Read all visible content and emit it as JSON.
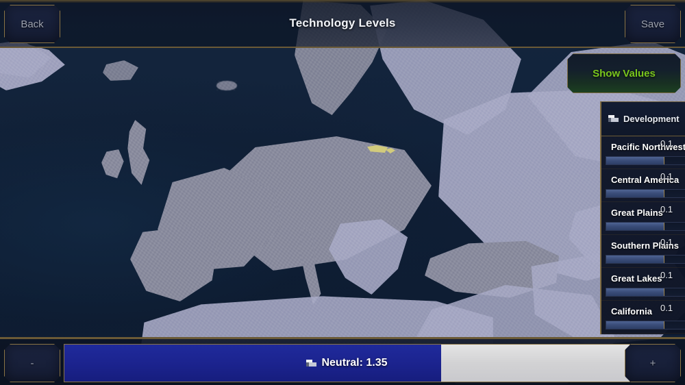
{
  "header": {
    "title": "Technology Levels",
    "back_label": "Back",
    "save_label": "Save"
  },
  "show_values": {
    "label": "Show Values",
    "color": "#79c61c"
  },
  "dev_panel": {
    "header_label": "Development",
    "header_icon": "flag-icon",
    "rows": [
      {
        "name": "Pacific Northwest",
        "value": "0.1",
        "fill_pct": 72
      },
      {
        "name": "Central America",
        "value": "0.1",
        "fill_pct": 72
      },
      {
        "name": "Great Plains",
        "value": "0.1",
        "fill_pct": 72
      },
      {
        "name": "Southern Plains",
        "value": "0.1",
        "fill_pct": 72
      },
      {
        "name": "Great Lakes",
        "value": "0.1",
        "fill_pct": 72
      },
      {
        "name": "California",
        "value": "0.1",
        "fill_pct": 72
      }
    ]
  },
  "bottom_bar": {
    "decrement_label": "-",
    "increment_label": "+",
    "slider_icon": "flag-icon",
    "slider_label": "Neutral: 1.35",
    "slider_fill_pct": 66.7,
    "fill_color": "#1c2490",
    "track_color": "#d8d8da"
  }
}
